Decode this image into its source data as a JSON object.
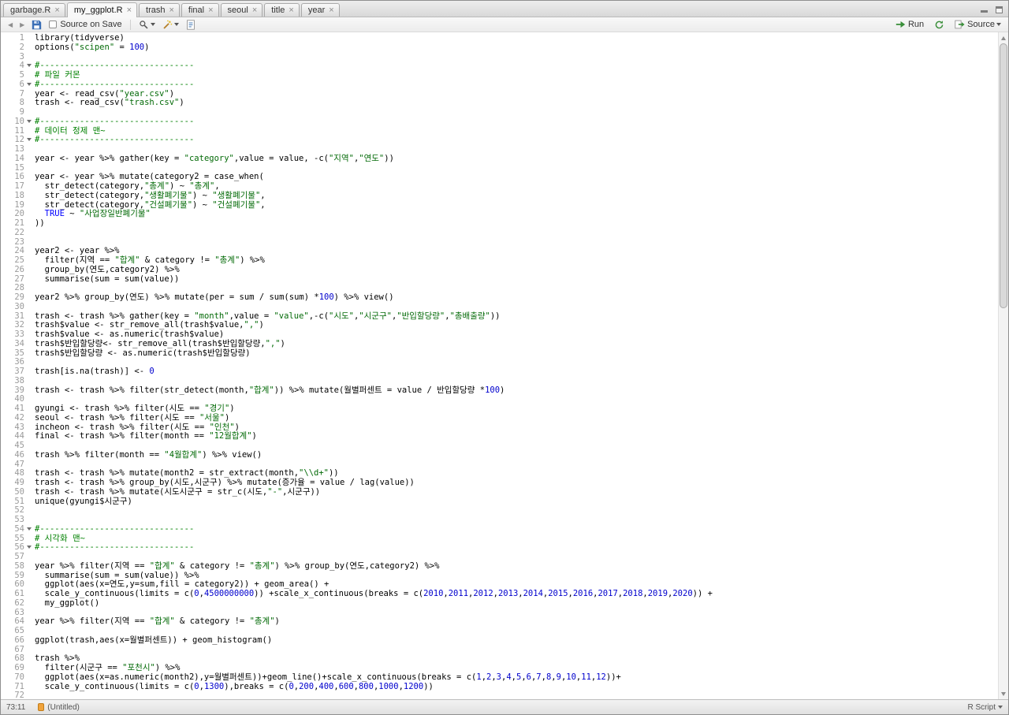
{
  "tab_bar": {
    "close_glyph": "×",
    "tabs": [
      {
        "label": "garbage.R",
        "active": false
      },
      {
        "label": "my_ggplot.R",
        "active": true
      },
      {
        "label": "trash",
        "active": false
      },
      {
        "label": "final",
        "active": false
      },
      {
        "label": "seoul",
        "active": false
      },
      {
        "label": "title",
        "active": false
      },
      {
        "label": "year",
        "active": false
      }
    ]
  },
  "toolbar": {
    "back_glyph": "◀",
    "forward_glyph": "▶",
    "source_on_save": {
      "label": "Source on Save",
      "checked": false
    },
    "run_label": "Run",
    "source_label": "Source"
  },
  "status_bar": {
    "cursor_position": "73:11",
    "current_section": "(Untitled)",
    "file_type": "R Script"
  },
  "colors": {
    "plain": "#000000",
    "comment": "#008000",
    "string": "#036A07",
    "number": "#0000CD",
    "keyword": "#0000FF",
    "run_icon_green": "#3a8f3a",
    "section_icon_orange": "#f0a33c"
  },
  "editor": {
    "language": "R",
    "fold_lines": [
      4,
      6,
      10,
      12,
      54,
      56
    ],
    "lines": [
      [
        [
          "p",
          "library(tidyverse)"
        ]
      ],
      [
        [
          "p",
          "options("
        ],
        [
          "s",
          "\"scipen\""
        ],
        [
          "p",
          " = "
        ],
        [
          "n",
          "100"
        ],
        [
          "p",
          ")"
        ]
      ],
      [],
      [
        [
          "c",
          "#-------------------------------"
        ]
      ],
      [
        [
          "c",
          "# 파일 커몬"
        ]
      ],
      [
        [
          "c",
          "#-------------------------------"
        ]
      ],
      [
        [
          "p",
          "year <- read_csv("
        ],
        [
          "s",
          "\"year.csv\""
        ],
        [
          "p",
          ")"
        ]
      ],
      [
        [
          "p",
          "trash <- read_csv("
        ],
        [
          "s",
          "\"trash.csv\""
        ],
        [
          "p",
          ")"
        ]
      ],
      [],
      [
        [
          "c",
          "#-------------------------------"
        ]
      ],
      [
        [
          "c",
          "# 데이터 정제 맨~"
        ]
      ],
      [
        [
          "c",
          "#-------------------------------"
        ]
      ],
      [],
      [
        [
          "p",
          "year <- year %>% gather(key = "
        ],
        [
          "s",
          "\"category\""
        ],
        [
          "p",
          ",value = value, -c("
        ],
        [
          "s",
          "\"지역\""
        ],
        [
          "p",
          ","
        ],
        [
          "s",
          "\"연도\""
        ],
        [
          "p",
          "))"
        ]
      ],
      [],
      [
        [
          "p",
          "year <- year %>% mutate(category2 = case_when("
        ]
      ],
      [
        [
          "p",
          "  str_detect(category,"
        ],
        [
          "s",
          "\"총계\""
        ],
        [
          "p",
          ") ~ "
        ],
        [
          "s",
          "\"총계\""
        ],
        [
          "p",
          ","
        ]
      ],
      [
        [
          "p",
          "  str_detect(category,"
        ],
        [
          "s",
          "\"생활폐기물\""
        ],
        [
          "p",
          ") ~ "
        ],
        [
          "s",
          "\"생활폐기물\""
        ],
        [
          "p",
          ","
        ]
      ],
      [
        [
          "p",
          "  str_detect(category,"
        ],
        [
          "s",
          "\"건설폐기물\""
        ],
        [
          "p",
          ") ~ "
        ],
        [
          "s",
          "\"건설폐기물\""
        ],
        [
          "p",
          ","
        ]
      ],
      [
        [
          "p",
          "  "
        ],
        [
          "k",
          "TRUE"
        ],
        [
          "p",
          " ~ "
        ],
        [
          "s",
          "\"사업장일반폐기물\""
        ]
      ],
      [
        [
          "p",
          "))"
        ]
      ],
      [],
      [],
      [
        [
          "p",
          "year2 <- year %>%"
        ]
      ],
      [
        [
          "p",
          "  filter(지역 == "
        ],
        [
          "s",
          "\"합계\""
        ],
        [
          "p",
          " & category != "
        ],
        [
          "s",
          "\"총계\""
        ],
        [
          "p",
          ") %>%"
        ]
      ],
      [
        [
          "p",
          "  group_by(연도,category2) %>%"
        ]
      ],
      [
        [
          "p",
          "  summarise(sum = sum(value))"
        ]
      ],
      [],
      [
        [
          "p",
          "year2 %>% group_by(연도) %>% mutate(per = sum / sum(sum) *"
        ],
        [
          "n",
          "100"
        ],
        [
          "p",
          ") %>% view()"
        ]
      ],
      [],
      [
        [
          "p",
          "trash <- trash %>% gather(key = "
        ],
        [
          "s",
          "\"month\""
        ],
        [
          "p",
          ",value = "
        ],
        [
          "s",
          "\"value\""
        ],
        [
          "p",
          ",-c("
        ],
        [
          "s",
          "\"시도\""
        ],
        [
          "p",
          ","
        ],
        [
          "s",
          "\"시군구\""
        ],
        [
          "p",
          ","
        ],
        [
          "s",
          "\"반입할당량\""
        ],
        [
          "p",
          ","
        ],
        [
          "s",
          "\"총배출량\""
        ],
        [
          "p",
          "))"
        ]
      ],
      [
        [
          "p",
          "trash$value <- str_remove_all(trash$value,"
        ],
        [
          "s",
          "\",\""
        ],
        [
          "p",
          ")"
        ]
      ],
      [
        [
          "p",
          "trash$value <- as.numeric(trash$value)"
        ]
      ],
      [
        [
          "p",
          "trash$반입할당량<- str_remove_all(trash$반입할당량,"
        ],
        [
          "s",
          "\",\""
        ],
        [
          "p",
          ")"
        ]
      ],
      [
        [
          "p",
          "trash$반입할당량 <- as.numeric(trash$반입할당량)"
        ]
      ],
      [],
      [
        [
          "p",
          "trash[is.na(trash)] <- "
        ],
        [
          "n",
          "0"
        ]
      ],
      [],
      [
        [
          "p",
          "trash <- trash %>% filter(str_detect(month,"
        ],
        [
          "s",
          "\"합계\""
        ],
        [
          "p",
          ")) %>% mutate(월별퍼센트 = value / 반입할당량 *"
        ],
        [
          "n",
          "100"
        ],
        [
          "p",
          ")"
        ]
      ],
      [],
      [
        [
          "p",
          "gyungi <- trash %>% filter(시도 == "
        ],
        [
          "s",
          "\"경기\""
        ],
        [
          "p",
          ")"
        ]
      ],
      [
        [
          "p",
          "seoul <- trash %>% filter(시도 == "
        ],
        [
          "s",
          "\"서울\""
        ],
        [
          "p",
          ")"
        ]
      ],
      [
        [
          "p",
          "incheon <- trash %>% filter(시도 == "
        ],
        [
          "s",
          "\"인천\""
        ],
        [
          "p",
          ")"
        ]
      ],
      [
        [
          "p",
          "final <- trash %>% filter(month == "
        ],
        [
          "s",
          "\"12월합계\""
        ],
        [
          "p",
          ")"
        ]
      ],
      [],
      [
        [
          "p",
          "trash %>% filter(month == "
        ],
        [
          "s",
          "\"4월합계\""
        ],
        [
          "p",
          ") %>% view()"
        ]
      ],
      [],
      [
        [
          "p",
          "trash <- trash %>% mutate(month2 = str_extract(month,"
        ],
        [
          "s",
          "\"\\\\d+\""
        ],
        [
          "p",
          "))"
        ]
      ],
      [
        [
          "p",
          "trash <- trash %>% group_by(시도,시군구) %>% mutate(증가율 = value / lag(value))"
        ]
      ],
      [
        [
          "p",
          "trash <- trash %>% mutate(시도시군구 = str_c(시도,"
        ],
        [
          "s",
          "\"-\""
        ],
        [
          "p",
          ",시군구))"
        ]
      ],
      [
        [
          "p",
          "unique(gyungi$시군구)"
        ]
      ],
      [],
      [],
      [
        [
          "c",
          "#-------------------------------"
        ]
      ],
      [
        [
          "c",
          "# 시각화 맨~"
        ]
      ],
      [
        [
          "c",
          "#-------------------------------"
        ]
      ],
      [],
      [
        [
          "p",
          "year %>% filter(지역 == "
        ],
        [
          "s",
          "\"합계\""
        ],
        [
          "p",
          " & category != "
        ],
        [
          "s",
          "\"총계\""
        ],
        [
          "p",
          ") %>% group_by(연도,category2) %>%"
        ]
      ],
      [
        [
          "p",
          "  summarise(sum = sum(value)) %>%"
        ]
      ],
      [
        [
          "p",
          "  ggplot(aes(x=연도,y=sum,fill = category2)) + geom_area() +"
        ]
      ],
      [
        [
          "p",
          "  scale_y_continuous(limits = c("
        ],
        [
          "n",
          "0"
        ],
        [
          "p",
          ","
        ],
        [
          "n",
          "4500000000"
        ],
        [
          "p",
          ")) +scale_x_continuous(breaks = c("
        ],
        [
          "n",
          "2010"
        ],
        [
          "p",
          ","
        ],
        [
          "n",
          "2011"
        ],
        [
          "p",
          ","
        ],
        [
          "n",
          "2012"
        ],
        [
          "p",
          ","
        ],
        [
          "n",
          "2013"
        ],
        [
          "p",
          ","
        ],
        [
          "n",
          "2014"
        ],
        [
          "p",
          ","
        ],
        [
          "n",
          "2015"
        ],
        [
          "p",
          ","
        ],
        [
          "n",
          "2016"
        ],
        [
          "p",
          ","
        ],
        [
          "n",
          "2017"
        ],
        [
          "p",
          ","
        ],
        [
          "n",
          "2018"
        ],
        [
          "p",
          ","
        ],
        [
          "n",
          "2019"
        ],
        [
          "p",
          ","
        ],
        [
          "n",
          "2020"
        ],
        [
          "p",
          ")) +"
        ]
      ],
      [
        [
          "p",
          "  my_ggplot()"
        ]
      ],
      [],
      [
        [
          "p",
          "year %>% filter(지역 == "
        ],
        [
          "s",
          "\"합계\""
        ],
        [
          "p",
          " & category != "
        ],
        [
          "s",
          "\"총계\""
        ],
        [
          "p",
          ")"
        ]
      ],
      [],
      [
        [
          "p",
          "ggplot(trash,aes(x=월별퍼센트)) + geom_histogram()"
        ]
      ],
      [],
      [
        [
          "p",
          "trash %>%"
        ]
      ],
      [
        [
          "p",
          "  filter(시군구 == "
        ],
        [
          "s",
          "\"포천시\""
        ],
        [
          "p",
          ") %>%"
        ]
      ],
      [
        [
          "p",
          "  ggplot(aes(x=as.numeric(month2),y=월별퍼센트))+geom_line()+scale_x_continuous(breaks = c("
        ],
        [
          "n",
          "1"
        ],
        [
          "p",
          ","
        ],
        [
          "n",
          "2"
        ],
        [
          "p",
          ","
        ],
        [
          "n",
          "3"
        ],
        [
          "p",
          ","
        ],
        [
          "n",
          "4"
        ],
        [
          "p",
          ","
        ],
        [
          "n",
          "5"
        ],
        [
          "p",
          ","
        ],
        [
          "n",
          "6"
        ],
        [
          "p",
          ","
        ],
        [
          "n",
          "7"
        ],
        [
          "p",
          ","
        ],
        [
          "n",
          "8"
        ],
        [
          "p",
          ","
        ],
        [
          "n",
          "9"
        ],
        [
          "p",
          ","
        ],
        [
          "n",
          "10"
        ],
        [
          "p",
          ","
        ],
        [
          "n",
          "11"
        ],
        [
          "p",
          ","
        ],
        [
          "n",
          "12"
        ],
        [
          "p",
          "))+"
        ]
      ],
      [
        [
          "p",
          "  scale_y_continuous(limits = c("
        ],
        [
          "n",
          "0"
        ],
        [
          "p",
          ","
        ],
        [
          "n",
          "1300"
        ],
        [
          "p",
          "),breaks = c("
        ],
        [
          "n",
          "0"
        ],
        [
          "p",
          ","
        ],
        [
          "n",
          "200"
        ],
        [
          "p",
          ","
        ],
        [
          "n",
          "400"
        ],
        [
          "p",
          ","
        ],
        [
          "n",
          "600"
        ],
        [
          "p",
          ","
        ],
        [
          "n",
          "800"
        ],
        [
          "p",
          ","
        ],
        [
          "n",
          "1000"
        ],
        [
          "p",
          ","
        ],
        [
          "n",
          "1200"
        ],
        [
          "p",
          "))"
        ]
      ],
      []
    ]
  }
}
